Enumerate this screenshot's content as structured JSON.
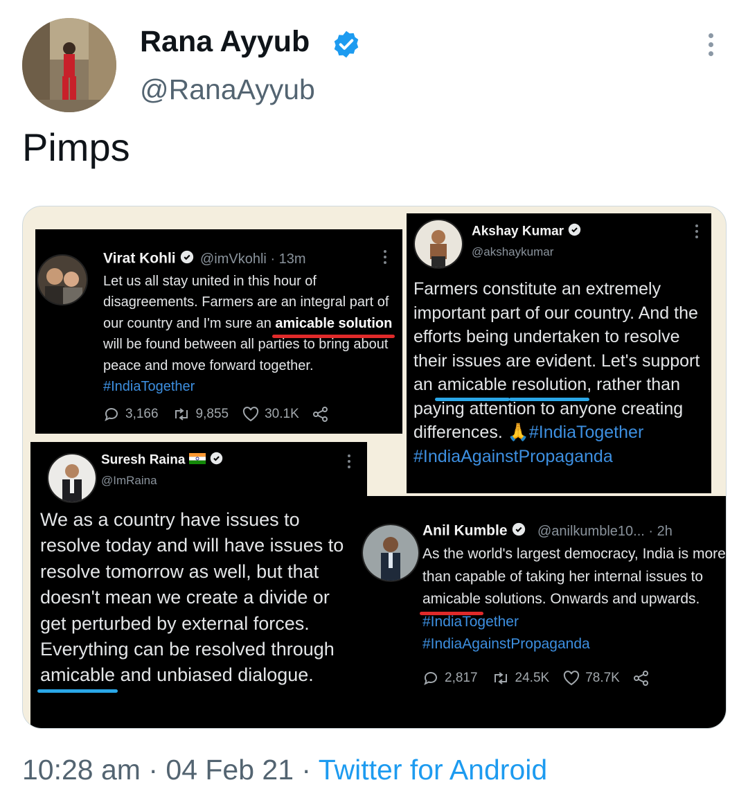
{
  "author": {
    "display_name": "Rana Ayyub",
    "handle": "@RanaAyyub",
    "avatar_icon": "profile-photo-icon",
    "verified_icon": "verified-badge-icon"
  },
  "tweet": {
    "text": "Pimps"
  },
  "media": {
    "kohli": {
      "name": "Virat Kohli",
      "handle": "@imVkohli",
      "time": "· 13m",
      "text_a": "Let us all stay united in this hour of disagreements. Farmers are an integral part of our country and I'm sure an ",
      "highlight": "amicable solution",
      "text_b": " will be found between all parties to bring about peace and move forward together. ",
      "hashtag": "#IndiaTogether",
      "replies": "3,166",
      "retweets": "9,855",
      "likes": "30.1K"
    },
    "akshay": {
      "name": "Akshay Kumar",
      "handle": "@akshaykumar",
      "text_a": "Farmers constitute an extremely important part of our country. And the efforts being undertaken to resolve their issues are evident. Let's support an ",
      "highlight_1": "amicable",
      "space": " ",
      "highlight_2": "resolution",
      "text_b": ", rather than paying attention to anyone creating differences. 🙏",
      "hashtag_1": "#IndiaTogether",
      "hashtag_2": "#IndiaAgainstPropaganda"
    },
    "raina": {
      "name": "Suresh Raina",
      "handle": "@ImRaina",
      "text_a": "We as a country have issues to resolve today and will have issues to resolve tomorrow as well, but that doesn't mean we create a divide or get perturbed by external forces. Everything can be resolved through ",
      "highlight": "amicable",
      "text_b": " and unbiased dialogue."
    },
    "kumble": {
      "name": "Anil Kumble",
      "handle": "@anilkumble10...",
      "time": "· 2h",
      "text_a": "As the world's largest democracy, India is more than capable of taking her internal issues to ",
      "highlight": "amicable",
      "text_b": " solutions. Onwards and upwards. ",
      "hashtag_1": "#IndiaTogether",
      "hashtag_2": "#IndiaAgainstPropaganda",
      "replies": "2,817",
      "retweets": "24.5K",
      "likes": "78.7K"
    }
  },
  "footer": {
    "time": "10:28 am",
    "sep1": " · ",
    "date": "04 Feb 21",
    "sep2": " · ",
    "source": "Twitter for Android"
  },
  "colors": {
    "accent": "#1d9bf0",
    "underline_red": "#e02a2a",
    "underline_blue": "#2aa7e8",
    "card_bg": "#000000"
  }
}
